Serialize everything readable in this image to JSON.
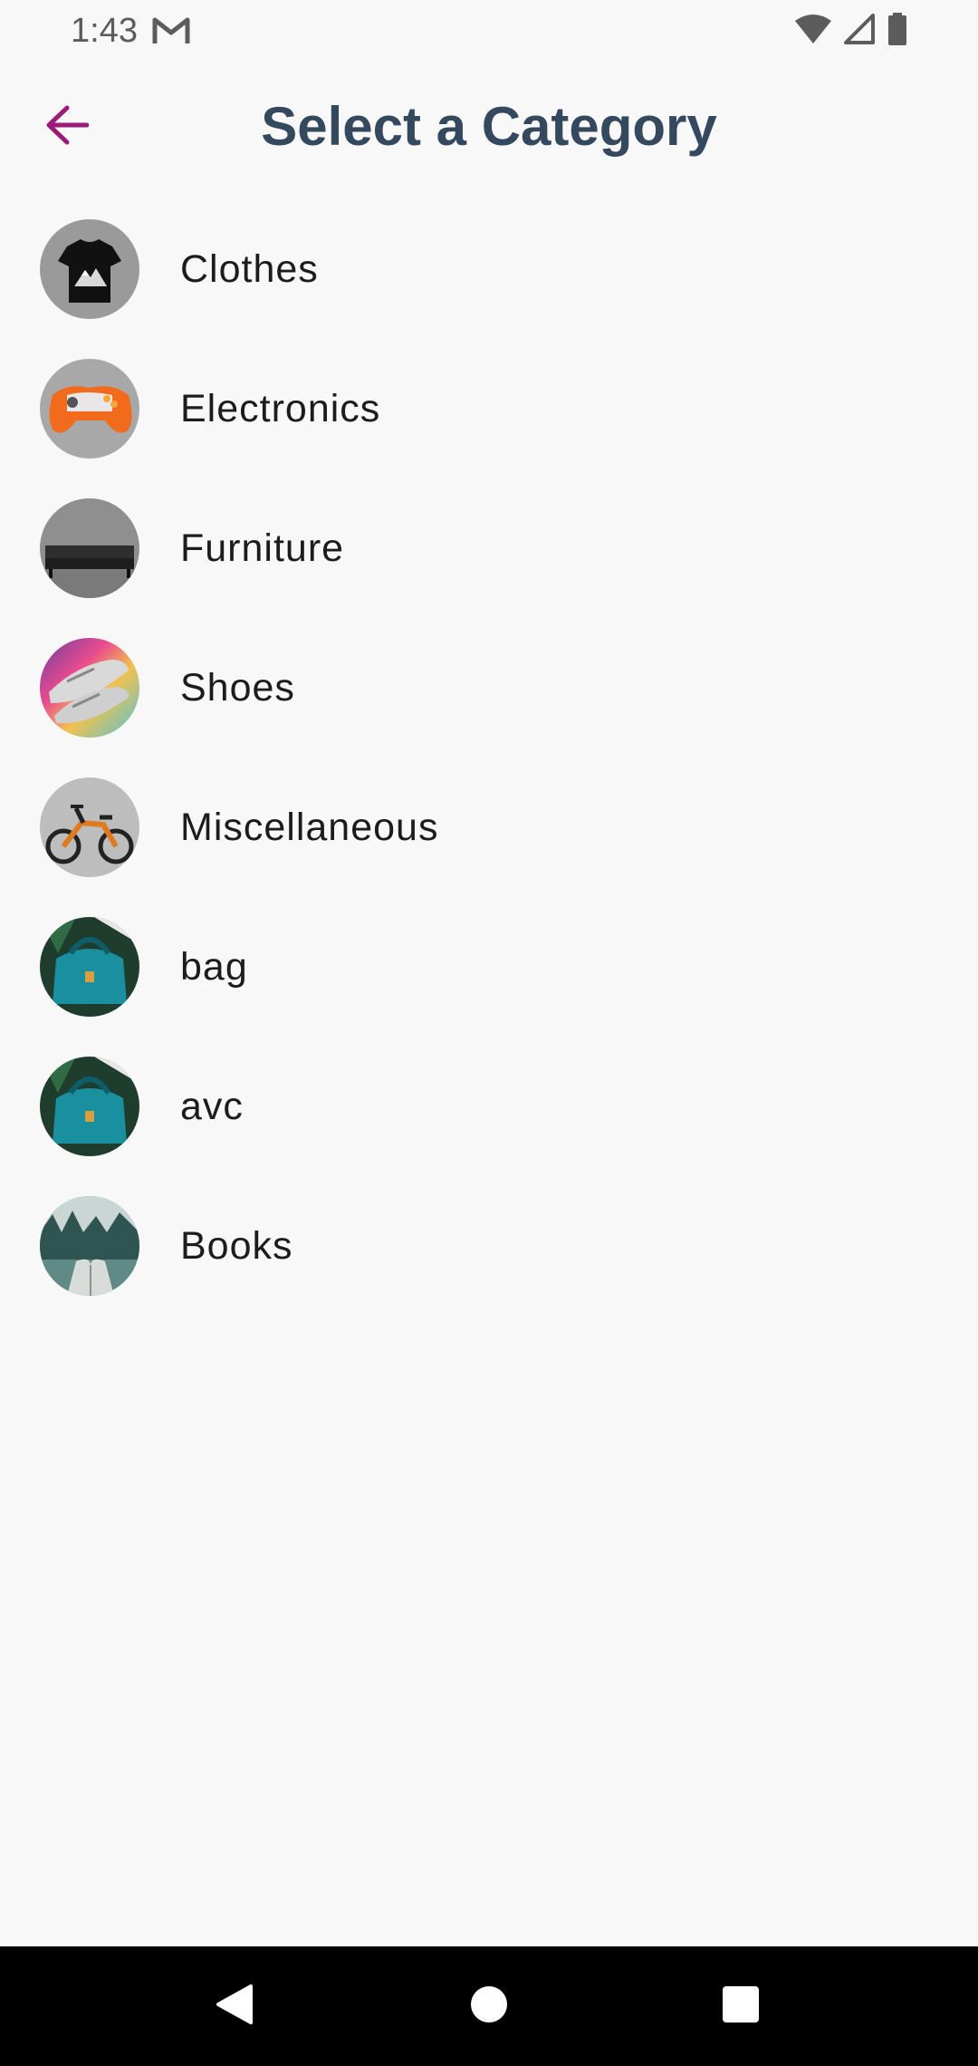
{
  "status_bar": {
    "time": "1:43",
    "icons": [
      "gmail-icon",
      "wifi-icon",
      "cell-signal-icon",
      "battery-icon"
    ]
  },
  "app_bar": {
    "title": "Select a Category",
    "back_icon": "arrow-left-icon",
    "accent_color": "#9c1a7a",
    "title_color": "#34495e"
  },
  "categories": [
    {
      "label": "Clothes",
      "thumb": "t-shirt-photo"
    },
    {
      "label": "Electronics",
      "thumb": "game-controller-photo"
    },
    {
      "label": "Furniture",
      "thumb": "sofa-photo"
    },
    {
      "label": "Shoes",
      "thumb": "sneakers-photo"
    },
    {
      "label": "Miscellaneous",
      "thumb": "e-bike-photo"
    },
    {
      "label": "bag",
      "thumb": "teal-handbag-photo"
    },
    {
      "label": "avc",
      "thumb": "teal-handbag-photo"
    },
    {
      "label": "Books",
      "thumb": "open-book-forest-photo"
    }
  ],
  "nav_bar": {
    "buttons": [
      "back-triangle-icon",
      "home-circle-icon",
      "recents-square-icon"
    ]
  }
}
